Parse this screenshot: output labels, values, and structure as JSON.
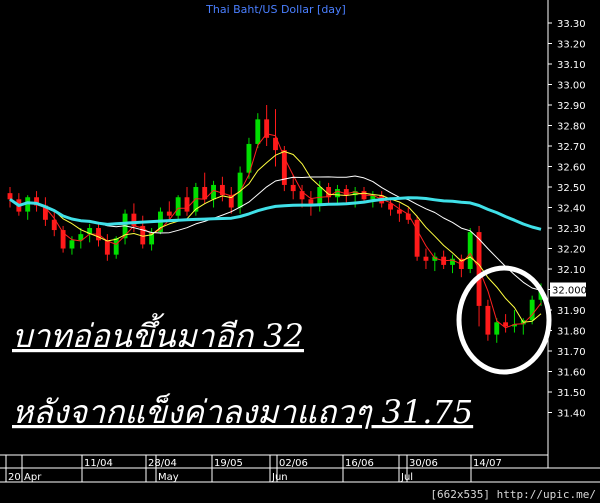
{
  "chart_data": {
    "type": "candlestick",
    "title": "Thai Baht/US Dollar [day]",
    "y_ticks": [
      "33.30",
      "33.20",
      "33.10",
      "33.00",
      "32.90",
      "32.80",
      "32.70",
      "32.60",
      "32.50",
      "32.40",
      "32.30",
      "32.20",
      "32.10",
      "32.00",
      "31.90",
      "31.80",
      "31.70",
      "31.60",
      "31.50",
      "31.40"
    ],
    "ylim": [
      31.33,
      33.35
    ],
    "last_price_label": "32.000",
    "last_price": 32.0,
    "x_labels": [
      "20",
      "Apr",
      "11/04",
      "28/04",
      "May",
      "19/05",
      "02/06",
      "Jun",
      "16/06",
      "30/06",
      "Jul",
      "14/07"
    ],
    "candles": [
      [
        32.47,
        32.5,
        32.4,
        32.44
      ],
      [
        32.44,
        32.47,
        32.36,
        32.38
      ],
      [
        32.38,
        32.46,
        32.34,
        32.45
      ],
      [
        32.45,
        32.48,
        32.38,
        32.41
      ],
      [
        32.41,
        32.45,
        32.31,
        32.34
      ],
      [
        32.34,
        32.38,
        32.26,
        32.29
      ],
      [
        32.29,
        32.31,
        32.18,
        32.2
      ],
      [
        32.2,
        32.26,
        32.17,
        32.24
      ],
      [
        32.24,
        32.3,
        32.2,
        32.27
      ],
      [
        32.27,
        32.32,
        32.23,
        32.3
      ],
      [
        32.3,
        32.33,
        32.21,
        32.24
      ],
      [
        32.24,
        32.27,
        32.14,
        32.17
      ],
      [
        32.17,
        32.26,
        32.15,
        32.25
      ],
      [
        32.25,
        32.39,
        32.22,
        32.37
      ],
      [
        32.37,
        32.42,
        32.28,
        32.31
      ],
      [
        32.31,
        32.36,
        32.2,
        32.22
      ],
      [
        32.22,
        32.3,
        32.19,
        32.28
      ],
      [
        32.28,
        32.4,
        32.27,
        32.38
      ],
      [
        32.38,
        32.43,
        32.33,
        32.36
      ],
      [
        32.36,
        32.46,
        32.34,
        32.45
      ],
      [
        32.45,
        32.5,
        32.36,
        32.38
      ],
      [
        32.38,
        32.52,
        32.36,
        32.5
      ],
      [
        32.5,
        32.57,
        32.42,
        32.44
      ],
      [
        32.44,
        32.53,
        32.4,
        32.51
      ],
      [
        32.51,
        32.55,
        32.43,
        32.46
      ],
      [
        32.46,
        32.5,
        32.37,
        32.4
      ],
      [
        32.4,
        32.6,
        32.37,
        32.57
      ],
      [
        32.57,
        32.74,
        32.54,
        32.71
      ],
      [
        32.71,
        32.86,
        32.69,
        32.83
      ],
      [
        32.83,
        32.9,
        32.7,
        32.74
      ],
      [
        32.74,
        32.88,
        32.6,
        32.68
      ],
      [
        32.68,
        32.7,
        32.48,
        32.51
      ],
      [
        32.51,
        32.56,
        32.44,
        32.48
      ],
      [
        32.48,
        32.51,
        32.4,
        32.44
      ],
      [
        32.44,
        32.48,
        32.36,
        32.41
      ],
      [
        32.41,
        32.53,
        32.38,
        32.5
      ],
      [
        32.5,
        32.52,
        32.41,
        32.45
      ],
      [
        32.45,
        32.51,
        32.42,
        32.49
      ],
      [
        32.49,
        32.51,
        32.42,
        32.46
      ],
      [
        32.46,
        32.5,
        32.4,
        32.48
      ],
      [
        32.48,
        32.5,
        32.42,
        32.44
      ],
      [
        32.44,
        32.48,
        32.4,
        32.46
      ],
      [
        32.46,
        32.48,
        32.4,
        32.42
      ],
      [
        32.42,
        32.45,
        32.36,
        32.39
      ],
      [
        32.39,
        32.42,
        32.33,
        32.37
      ],
      [
        32.37,
        32.4,
        32.32,
        32.34
      ],
      [
        32.34,
        32.36,
        32.14,
        32.16
      ],
      [
        32.16,
        32.2,
        32.1,
        32.14
      ],
      [
        32.14,
        32.18,
        32.09,
        32.16
      ],
      [
        32.16,
        32.19,
        32.1,
        32.12
      ],
      [
        32.12,
        32.17,
        32.08,
        32.15
      ],
      [
        32.15,
        32.17,
        32.06,
        32.1
      ],
      [
        32.1,
        32.3,
        32.08,
        32.28
      ],
      [
        32.28,
        32.31,
        31.82,
        31.92
      ],
      [
        31.92,
        31.95,
        31.75,
        31.78
      ],
      [
        31.78,
        31.86,
        31.74,
        31.84
      ],
      [
        31.84,
        31.88,
        31.79,
        31.82
      ],
      [
        31.82,
        31.9,
        31.79,
        31.83
      ],
      [
        31.83,
        31.86,
        31.78,
        31.85
      ],
      [
        31.85,
        31.97,
        31.83,
        31.95
      ],
      [
        31.95,
        32.03,
        31.92,
        32.0
      ]
    ],
    "series": [
      {
        "color": "#ff2020",
        "width": 1
      },
      {
        "color": "#ffff40",
        "width": 1
      },
      {
        "color": "#ffffff",
        "width": 1
      },
      {
        "color": "#40e0e8",
        "width": 3
      }
    ],
    "annotations": [
      {
        "text": "บาทอ่อนขึ้นมาอีก 32"
      },
      {
        "text": "หลังจากแข็งค่าลงมาแถวๆ 31.75"
      }
    ],
    "grid": false,
    "colors": {
      "up": "#00dd00",
      "down": "#ff1a1a",
      "axis": "#ffffff",
      "title": "#4a7fff",
      "bg": "#000000"
    }
  },
  "footer": "[662x535] http://upic.me/"
}
